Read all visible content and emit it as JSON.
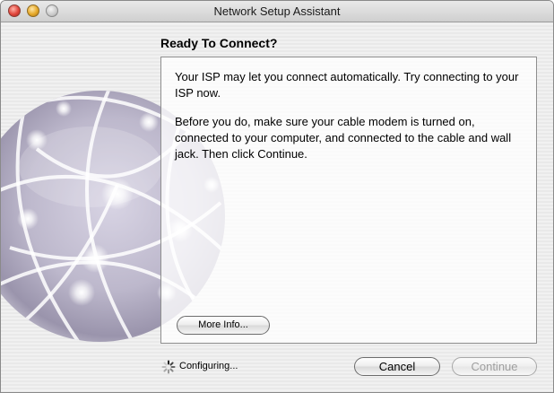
{
  "window": {
    "title": "Network Setup Assistant"
  },
  "main": {
    "heading": "Ready To Connect?",
    "paragraphs": [
      "Your ISP may let you connect automatically. Try connecting to your ISP now.",
      "Before you do, make sure your cable modem is turned on, connected to your computer, and connected to the cable and wall jack. Then click Continue."
    ],
    "more_info_label": "More Info..."
  },
  "footer": {
    "status_text": "Configuring...",
    "cancel_label": "Cancel",
    "continue_label": "Continue",
    "continue_enabled": false
  },
  "icons": {
    "close": "close-icon",
    "minimize": "minimize-icon",
    "zoom": "zoom-icon",
    "spinner": "progress-spinner-icon",
    "illustration": "network-globe-icon"
  },
  "colors": {
    "close": "#e0443a",
    "minimize": "#e5a828",
    "zoom": "#c9c9c9",
    "disabled_text": "#9e9e9e"
  }
}
